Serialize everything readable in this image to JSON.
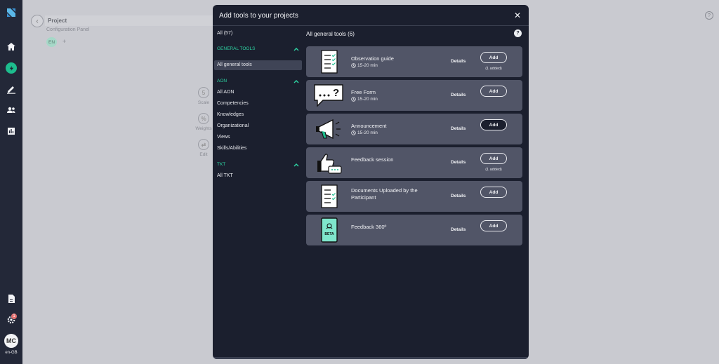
{
  "rail": {
    "avatar_initials": "MC",
    "locale": "en-GB",
    "notification_count": "1",
    "accent_color": "#1dbd8e"
  },
  "background": {
    "project_title": "Project",
    "project_subtitle": "Configuration Panel",
    "language_chip": "EN",
    "add_language": "+",
    "side_tools": [
      {
        "icon": "5",
        "label": "Scale"
      },
      {
        "icon": "%",
        "label": "Weights"
      },
      {
        "icon": "⇄",
        "label": "Edit"
      }
    ]
  },
  "modal": {
    "title": "Add tools to your projects",
    "close": "✕",
    "categories": {
      "all": "All (57)",
      "groups": [
        {
          "heading": "GENERAL TOOLS",
          "items": [
            "All general tools"
          ]
        },
        {
          "heading": "AON",
          "items": [
            "All AON",
            "Competencies",
            "Knowledges",
            "Organizational",
            "Views",
            "Skills/Abilities"
          ]
        },
        {
          "heading": "TKT",
          "items": [
            "All TKT"
          ]
        }
      ],
      "selected": "All general tools"
    },
    "list_title": "All general tools (6)",
    "help": "?",
    "tools": [
      {
        "name": "Observation guide",
        "duration": "15-20 min",
        "details": "Details",
        "add": "Add",
        "added": "(1 added)",
        "icon": "checklist-icon"
      },
      {
        "name": "Free Form",
        "duration": "15-20 min",
        "details": "Details",
        "add": "Add",
        "added": "",
        "icon": "speech-bubble-icon"
      },
      {
        "name": "Announcement",
        "duration": "15-20 min",
        "details": "Details",
        "add": "Add",
        "added": "",
        "icon": "megaphone-icon"
      },
      {
        "name": "Feedback session",
        "duration": "",
        "details": "Details",
        "add": "Add",
        "added": "(1 added)",
        "icon": "thumbs-up-icon"
      },
      {
        "name": "Documents Uploaded by the Participant",
        "duration": "",
        "details": "Details",
        "add": "Add",
        "added": "",
        "icon": "document-icon"
      },
      {
        "name": "Feedback 360º",
        "duration": "",
        "details": "Details",
        "add": "Add",
        "added": "",
        "icon": "beta-tablet-icon",
        "badge": "BETA"
      }
    ]
  }
}
